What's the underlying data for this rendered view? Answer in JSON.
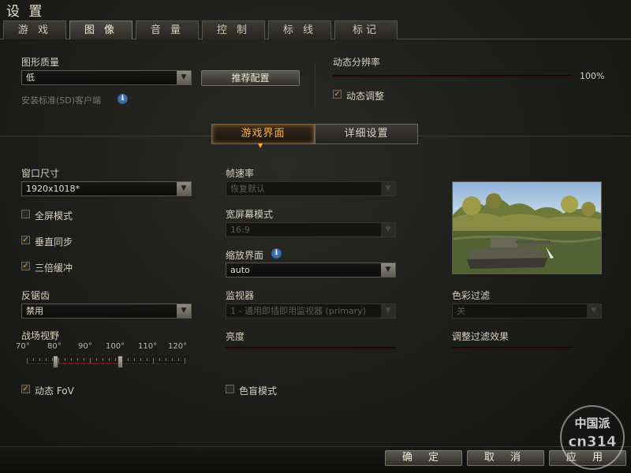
{
  "window": {
    "title": "设 置"
  },
  "tabs": [
    {
      "label": "游 戏"
    },
    {
      "label": "图 像"
    },
    {
      "label": "音 量"
    },
    {
      "label": "控 制"
    },
    {
      "label": "标 线"
    },
    {
      "label": "标记"
    }
  ],
  "graphics": {
    "quality_label": "图形质量",
    "quality_value": "低",
    "recommend_label": "推荐配置",
    "sd_client_label": "安装标准(SD)客户端"
  },
  "dynamic_resolution": {
    "label": "动态分辨率",
    "value_text": "100%",
    "value": 1.0,
    "adjust_label": "动态调整",
    "adjust_checked": true
  },
  "subtabs": {
    "game_ui": "游戏界面",
    "advanced": "详细设置"
  },
  "left": {
    "window_size_label": "窗口尺寸",
    "window_size_value": "1920x1018*",
    "fullscreen_label": "全屏模式",
    "fullscreen_checked": false,
    "vsync_label": "垂直同步",
    "vsync_checked": true,
    "triple_buffer_label": "三倍缓冲",
    "triple_buffer_checked": true,
    "aa_label": "反锯齿",
    "aa_value": "禁用",
    "fov_label": "战场视野",
    "fov_ticks": [
      "70°",
      "80°",
      "90°",
      "100°",
      "110°",
      "120°"
    ],
    "fov_min": 80,
    "fov_max": 100,
    "dynamic_fov_label": "动态 FoV",
    "dynamic_fov_checked": true
  },
  "middle": {
    "framerate_label": "帧速率",
    "framerate_value": "恢复默认",
    "widescreen_label": "宽屏幕模式",
    "widescreen_value": "16:9",
    "scale_label": "缩放界面",
    "scale_value": "auto",
    "monitor_label": "监视器",
    "monitor_value": "1 - 通用即插即用监视器 (primary)",
    "brightness_label": "亮度",
    "colorblind_label": "色盲模式",
    "colorblind_checked": false
  },
  "right": {
    "color_filter_label": "色彩过滤",
    "color_filter_value": "关",
    "filter_effect_label": "调整过滤效果"
  },
  "bottom": {
    "ok": "确 定",
    "cancel": "取 消",
    "apply": "应 用"
  },
  "watermark": {
    "line1": "中国派",
    "line2": "cn314"
  },
  "colors": {
    "accent": "#ffa63a",
    "slider": "#7a1a14",
    "checkmark": "#e8a23a"
  }
}
